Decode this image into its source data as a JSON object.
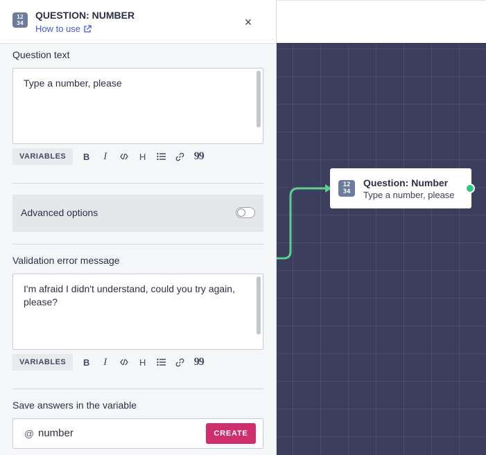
{
  "panel": {
    "icon_glyph_top": "12",
    "icon_glyph_bottom": "34",
    "title": "QUESTION: NUMBER",
    "how_to_use": "How to use",
    "close": "×",
    "question_text": {
      "label": "Question text",
      "value": "Type a number, please"
    },
    "toolbar": {
      "variables": "VARIABLES",
      "bold": "B",
      "italic": "I",
      "heading": "H",
      "quote": "99"
    },
    "advanced": {
      "label": "Advanced options",
      "enabled": false
    },
    "validation": {
      "label": "Validation error message",
      "value": "I'm afraid I didn't understand, could you try again, please?"
    },
    "save": {
      "label": "Save answers in the variable",
      "at": "@",
      "variable": "number",
      "create": "CREATE"
    }
  },
  "node": {
    "title": "Question: Number",
    "subtitle": "Type a number, please"
  },
  "colors": {
    "accent": "#3f57d6",
    "create": "#cf2f6c",
    "canvas": "#3b3e5c",
    "edge": "#5ecf8e",
    "port": "#32c28a"
  }
}
